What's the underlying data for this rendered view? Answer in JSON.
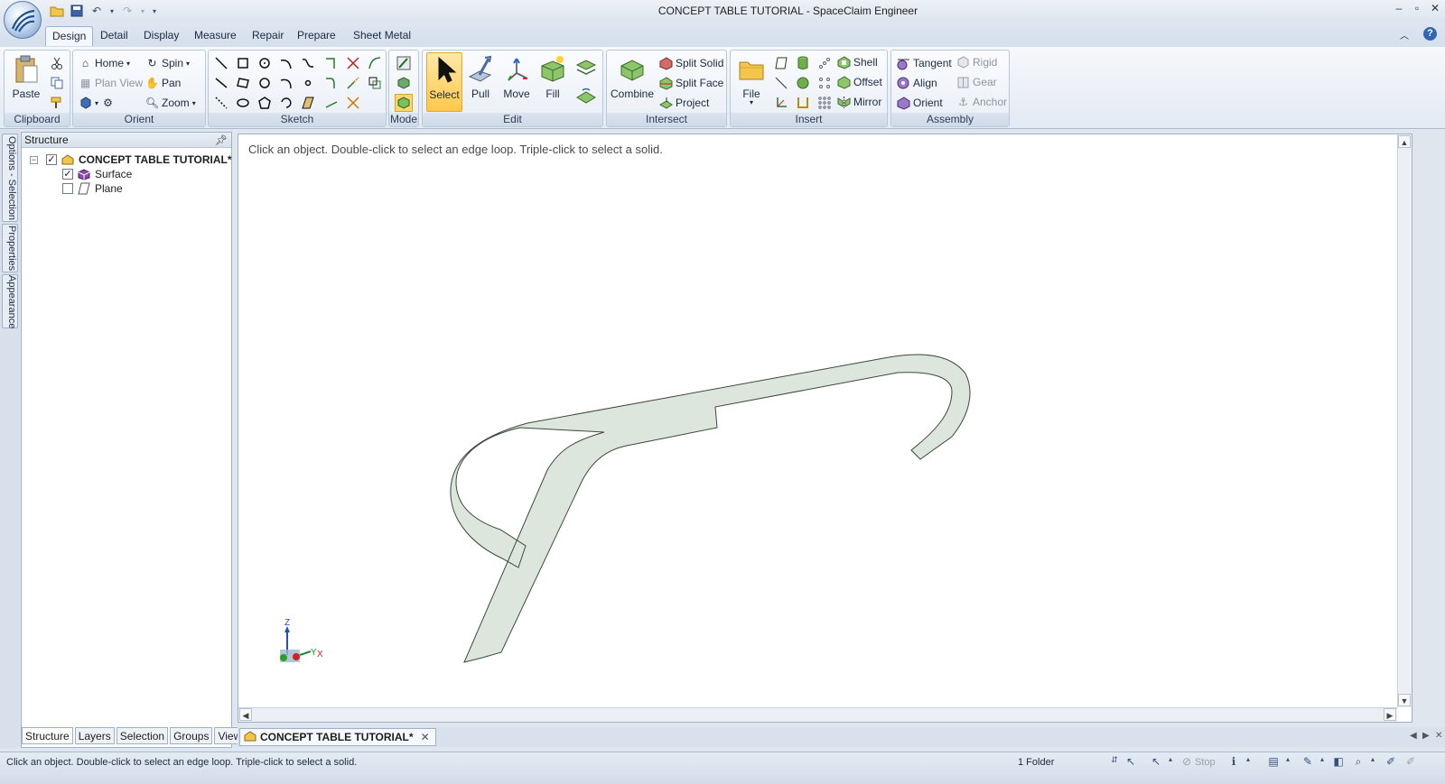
{
  "window": {
    "title": "CONCEPT TABLE TUTORIAL - SpaceClaim Engineer"
  },
  "ribbon_tabs": [
    "Design",
    "Detail",
    "Display",
    "Measure",
    "Repair",
    "Prepare",
    "Sheet Metal"
  ],
  "active_tab": "Design",
  "groups": {
    "clipboard": {
      "label": "Clipboard",
      "paste": "Paste"
    },
    "orient": {
      "label": "Orient",
      "home": "Home",
      "plan_view": "Plan View",
      "spin": "Spin",
      "pan": "Pan",
      "zoom": "Zoom"
    },
    "sketch": {
      "label": "Sketch"
    },
    "mode": {
      "label": "Mode"
    },
    "edit": {
      "label": "Edit",
      "select": "Select",
      "pull": "Pull",
      "move": "Move",
      "fill": "Fill"
    },
    "intersect": {
      "label": "Intersect",
      "combine": "Combine",
      "split_solid": "Split Solid",
      "split_face": "Split Face",
      "project": "Project"
    },
    "insert": {
      "label": "Insert",
      "file": "File",
      "shell": "Shell",
      "offset": "Offset",
      "mirror": "Mirror"
    },
    "assembly": {
      "label": "Assembly",
      "tangent": "Tangent",
      "align": "Align",
      "orient": "Orient",
      "rigid": "Rigid",
      "gear": "Gear",
      "anchor": "Anchor"
    }
  },
  "side_tabs": [
    "Options - Selection",
    "Properties",
    "Appearance"
  ],
  "structure": {
    "header": "Structure",
    "root": "CONCEPT TABLE TUTORIAL*",
    "children": [
      {
        "label": "Surface",
        "checked": true
      },
      {
        "label": "Plane",
        "checked": false
      }
    ]
  },
  "panel_tabs": [
    "Structure",
    "Layers",
    "Selection",
    "Groups",
    "Views"
  ],
  "viewport": {
    "hint": "Click an object. Double-click to select an edge loop. Triple-click to select a solid.",
    "surface_fill": "#dce6dc",
    "surface_stroke": "#3c4a3c",
    "axis": {
      "z": "Z",
      "y": "Y",
      "x": "X"
    }
  },
  "doc_tab": "CONCEPT TABLE TUTORIAL*",
  "status": {
    "text": "Click an object. Double-click to select an edge loop. Triple-click to select a solid.",
    "folders": "1 Folder",
    "stop": "Stop"
  }
}
